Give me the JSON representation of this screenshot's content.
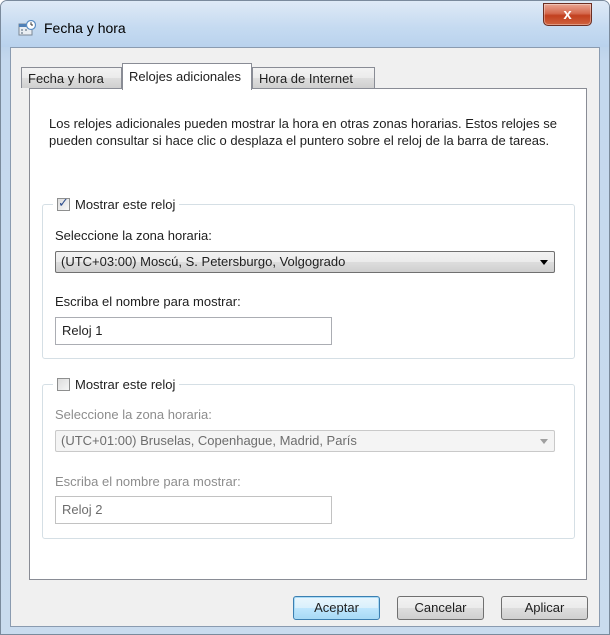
{
  "window": {
    "title": "Fecha y hora",
    "close_label": "x"
  },
  "tabs": [
    {
      "label": "Fecha y hora",
      "active": false
    },
    {
      "label": "Relojes adicionales",
      "active": true
    },
    {
      "label": "Hora de Internet",
      "active": false
    }
  ],
  "intro_text": "Los relojes adicionales pueden mostrar la hora en otras zonas horarias. Estos relojes se pueden consultar si hace clic o desplaza el puntero sobre el reloj de la barra de tareas.",
  "clock1": {
    "checkbox_label": "Mostrar este reloj",
    "checked": true,
    "timezone_label": "Seleccione la zona horaria:",
    "timezone_value": "(UTC+03:00) Moscú, S. Petersburgo, Volgogrado",
    "name_label": "Escriba el nombre para mostrar:",
    "name_value": "Reloj 1"
  },
  "clock2": {
    "checkbox_label": "Mostrar este reloj",
    "checked": false,
    "timezone_label": "Seleccione la zona horaria:",
    "timezone_value": "(UTC+01:00) Bruselas, Copenhague, Madrid, París",
    "name_label": "Escriba el nombre para mostrar:",
    "name_value": "Reloj 2"
  },
  "buttons": {
    "ok": "Aceptar",
    "cancel": "Cancelar",
    "apply": "Aplicar"
  },
  "colors": {
    "close_button": "#c2401f",
    "default_button_border": "#3c7fb1",
    "checkmark": "#2f4f8f"
  }
}
